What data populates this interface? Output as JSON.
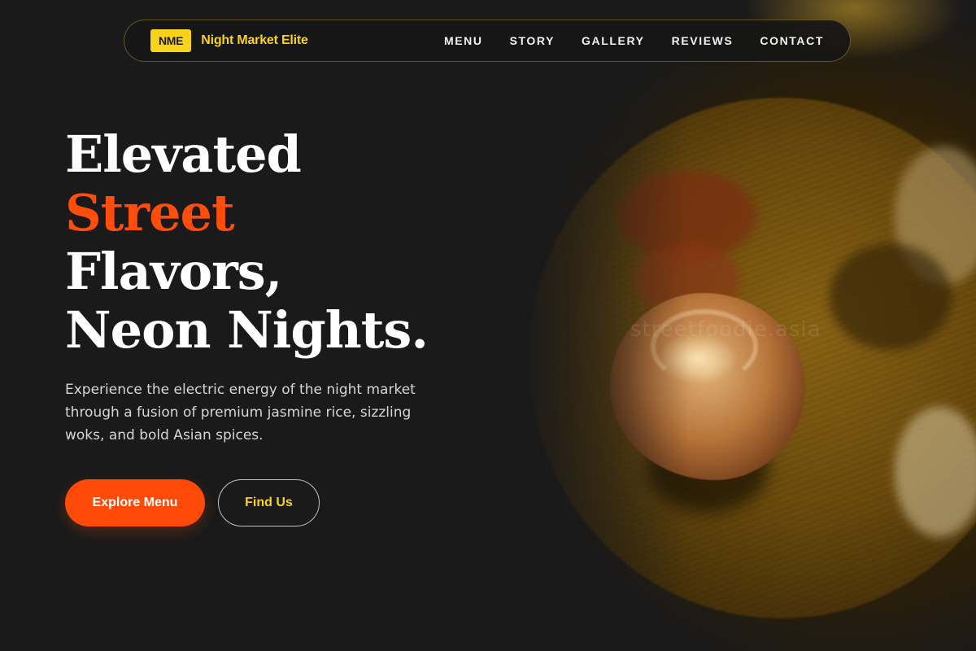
{
  "brand": {
    "badge": "NME",
    "name": "Night Market Elite"
  },
  "nav": {
    "items": [
      {
        "label": "MENU"
      },
      {
        "label": "STORY"
      },
      {
        "label": "GALLERY"
      },
      {
        "label": "REVIEWS"
      },
      {
        "label": "CONTACT"
      }
    ]
  },
  "hero": {
    "title_line1": "Elevated",
    "title_line2": "Street",
    "title_line3": "Flavors,",
    "title_line4": "Neon Nights.",
    "subtitle": "Experience the electric energy of the night market through a fusion of premium jasmine rice, sizzling woks, and bold Asian spices.",
    "primary_cta": "Explore Menu",
    "secondary_cta": "Find Us",
    "image_watermark": "streetfoodie.asia"
  },
  "colors": {
    "background": "#1a1a1a",
    "accent_orange": "#ff4d0b",
    "accent_yellow": "#f9d21a",
    "text_white": "#ffffff"
  }
}
